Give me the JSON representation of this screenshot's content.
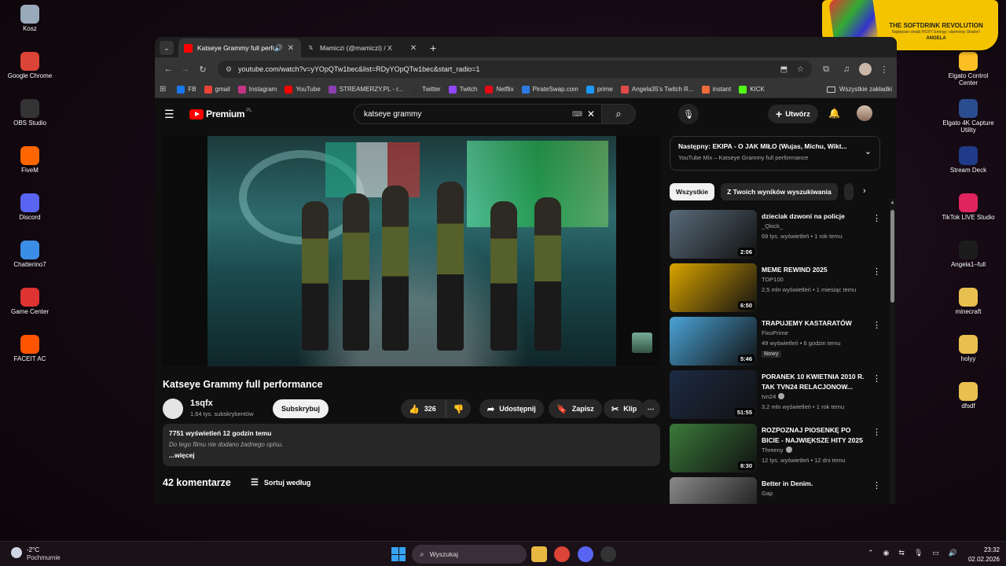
{
  "desktop": {
    "left_icons": [
      {
        "label": "Kosz",
        "icon": "recycle-bin-icon",
        "color": "#9ab"
      },
      {
        "label": "Google Chrome",
        "icon": "chrome-icon",
        "color": "#db4437"
      },
      {
        "label": "OBS Studio",
        "icon": "obs-icon",
        "color": "#333"
      },
      {
        "label": "FiveM",
        "icon": "fivem-icon",
        "color": "#f60"
      },
      {
        "label": "Discord",
        "icon": "discord-icon",
        "color": "#5865f2"
      },
      {
        "label": "Chatterino7",
        "icon": "chatterino-icon",
        "color": "#3a8ee6"
      },
      {
        "label": "Game Center",
        "icon": "game-center-icon",
        "color": "#d33"
      },
      {
        "label": "FACEIT AC",
        "icon": "faceit-icon",
        "color": "#f50"
      }
    ],
    "right_icons": [
      {
        "label": "",
        "icon": "folder-icon",
        "color": "#e8c050"
      },
      {
        "label": "Elgato Control Center",
        "icon": "elgato-icon",
        "color": "#fbbf24"
      },
      {
        "label": "Elgato 4K Capture Utility",
        "icon": "elgato-4k-icon",
        "color": "#2a4d8f"
      },
      {
        "label": "Stream Deck",
        "icon": "stream-deck-icon",
        "color": "#1f3b88"
      },
      {
        "label": "TikTok LIVE Studio",
        "icon": "tiktok-icon",
        "color": "#e0245e"
      },
      {
        "label": "Angela1–full",
        "icon": "image-file-icon",
        "color": "#1c1c1c"
      },
      {
        "label": "minecraft",
        "icon": "folder-icon",
        "color": "#e8c050"
      },
      {
        "label": "holyy",
        "icon": "folder-icon",
        "color": "#e8c050"
      },
      {
        "label": "dfsdf",
        "icon": "folder-icon",
        "color": "#e8c050"
      }
    ]
  },
  "promo": {
    "title": "THE SOFTDRINK REVOLUTION",
    "subtitle": "Najlepsze smaki HOXY Energy i darmowy Shaker!",
    "name": "ANGELA"
  },
  "browser": {
    "tabs": [
      {
        "label": "Katseye Grammy full perfor",
        "icon": "youtube-favicon-icon",
        "active": true
      },
      {
        "label": "Mamiczi (@mamiczi) / X",
        "icon": "x-favicon-icon",
        "active": false
      }
    ],
    "new_tab": "+",
    "url": "youtube.com/watch?v=yYOpQTw1bec&list=RDyYOpQTw1bec&start_radio=1",
    "bookmarks": [
      {
        "label": "FB",
        "color": "#1877f2"
      },
      {
        "label": "gmail",
        "color": "#ea4335"
      },
      {
        "label": "Instagram",
        "color": "#c13584"
      },
      {
        "label": "YouTube",
        "color": "#ff0000"
      },
      {
        "label": "STREAMERZY.PL - r...",
        "color": "#8e3fb1"
      },
      {
        "label": "Twitter",
        "color": "#333333"
      },
      {
        "label": "Twitch",
        "color": "#9146ff"
      },
      {
        "label": "Netflix",
        "color": "#e50914"
      },
      {
        "label": "PirateSwap.com",
        "color": "#2c7be5"
      },
      {
        "label": "prime",
        "color": "#1a98ff"
      },
      {
        "label": "Angela35's Twitch R...",
        "color": "#e24a4a"
      },
      {
        "label": "instant",
        "color": "#f26b3a"
      },
      {
        "label": "KICK",
        "color": "#53fc18"
      }
    ],
    "all_bookmarks": "Wszystkie zakładki"
  },
  "youtube": {
    "logo": "Premium",
    "logo_country": "PL",
    "search_value": "katseye grammy",
    "create_label": "Utwórz",
    "video_title": "Katseye Grammy full performance",
    "channel": {
      "name": "1sqfx",
      "subs": "1,64 tys. subskrybentów"
    },
    "subscribe_label": "Subskrybuj",
    "likes": "326",
    "share_label": "Udostępnij",
    "save_label": "Zapisz",
    "clip_label": "Klip",
    "description": {
      "meta": "7751 wyświetleń  12 godzin temu",
      "text": "Do tego filmu nie dodano żadnego opisu.",
      "more": "...więcej"
    },
    "comments_count": "42 komentarze",
    "sort_label": "Sortuj według",
    "up_next": {
      "title": "Następny: EKIPA - O JAK MIŁO (Wujas, Michu, Wikt...",
      "subtitle": "YouTube Mix – Katseye Grammy full performance"
    },
    "chips": [
      "Wszystkie",
      "Z Twoich wyników wyszukiwania"
    ],
    "recommendations": [
      {
        "title": "dzieciak dzwoni na policje",
        "channel": "_Qkick_",
        "stats": "69 tys. wyświetleń • 1 rok temu",
        "duration": "2:06",
        "badge": "",
        "verified": false,
        "thumb": "#5a6b7a"
      },
      {
        "title": "MEME REWIND 2025",
        "channel": "TOP100",
        "stats": "2,5 mln wyświetleń • 1 miesiąc temu",
        "duration": "6:50",
        "badge": "",
        "verified": false,
        "thumb": "#d9a400"
      },
      {
        "title": "TRAPUJEMY KASTARATÓW",
        "channel": "FixoPrime",
        "stats": "49 wyświetleń • 6 godzin temu",
        "duration": "5:46",
        "badge": "Nowy",
        "verified": false,
        "thumb": "#4aa3d6"
      },
      {
        "title": "PORANEK 10 KWIETNIA 2010 R. TAK TVN24 RELACJONOW...",
        "channel": "tvn24",
        "stats": "3,2 mln wyświetleń • 1 rok temu",
        "duration": "51:55",
        "badge": "",
        "verified": true,
        "thumb": "#1d2b44"
      },
      {
        "title": "ROZPOZNAJ PIOSENKĘ PO BICIE - NAJWIĘKSZE HITY 2025",
        "channel": "Threeny",
        "stats": "12 tys. wyświetleń • 12 dni temu",
        "duration": "8:30",
        "badge": "",
        "verified": true,
        "thumb": "#3a7a3a"
      },
      {
        "title": "Better in Denim.",
        "channel": "Gap",
        "stats": "",
        "duration": "",
        "badge": "",
        "verified": false,
        "thumb": "#8a8a8a"
      }
    ]
  },
  "taskbar": {
    "temperature": "-2°C",
    "weather": "Pochmurnie",
    "search_placeholder": "Wyszukaj",
    "time": "23:32",
    "date": "02.02.2026"
  }
}
